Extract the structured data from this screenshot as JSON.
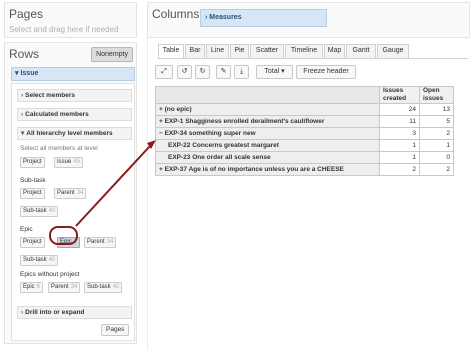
{
  "pages": {
    "title": "Pages",
    "hint": "Select and drag here if needed"
  },
  "rows": {
    "title": "Rows",
    "nonempty_label": "Nonempty",
    "dimension": "Issue",
    "sections": {
      "select_members": "Select members",
      "calculated_members": "Calculated members",
      "all_hierarchy": "All hierarchy level members",
      "drill": "Drill into or expand"
    },
    "level_hint": "Select all members at level",
    "row1": {
      "project": "Project",
      "issue": "Issue",
      "issue_count": "45"
    },
    "subtask_heading": "Sub-task",
    "row2": {
      "project": "Project",
      "parent": "Parent",
      "parent_count": "34",
      "subtask": "Sub-task",
      "subtask_count": "40"
    },
    "epic_heading": "Epic",
    "row3": {
      "project": "Project",
      "epic": "Epic",
      "epic_count": "6",
      "parent": "Parent",
      "parent_count": "34",
      "subtask": "Sub-task",
      "subtask_count": "40"
    },
    "epics_without_heading": "Epics without project",
    "row4": {
      "epic": "Epic",
      "epic_count": "6",
      "parent": "Parent",
      "parent_count": "34",
      "subtask": "Sub-task",
      "subtask_count": "40"
    },
    "pages_button": "Pages"
  },
  "columns": {
    "title": "Columns",
    "measures": "Measures"
  },
  "tabs": [
    "Table",
    "Bar",
    "Line",
    "Pie",
    "Scatter",
    "Timeline",
    "Map",
    "Gantt",
    "Gauge"
  ],
  "toolbar": {
    "expand_icon": "expand-arrows-icon",
    "undo_icon": "undo-icon",
    "redo_icon": "redo-icon",
    "comment_icon": "comment-icon",
    "download_icon": "download-icon",
    "total_label": "Total",
    "freeze_label": "Freeze header"
  },
  "table": {
    "headers": [
      "Issues created",
      "Open issues"
    ],
    "rows": [
      {
        "label": "+ (no epic)",
        "created": "24",
        "open": "13"
      },
      {
        "label": "+ EXP-1 Shagginess enrolled derailment's cauliflower",
        "created": "11",
        "open": "5"
      },
      {
        "label": "− EXP-34 something super new",
        "created": "3",
        "open": "2"
      },
      {
        "label": "EXP-22 Concerns greatest margaret",
        "created": "1",
        "open": "1"
      },
      {
        "label": "EXP-23 One order all scale sense",
        "created": "1",
        "open": "0"
      },
      {
        "label": "+ EXP-37 Age is of no importance unless you are a CHEESE",
        "created": "2",
        "open": "2"
      }
    ]
  },
  "colors": {
    "annotation": "#8b1b1b",
    "dimension_bg": "#d7e6f5"
  }
}
